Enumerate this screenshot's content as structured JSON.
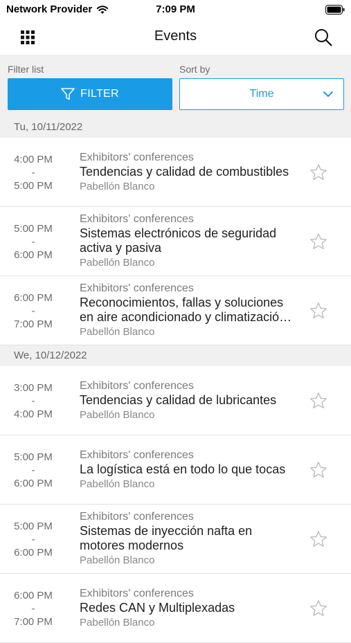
{
  "status": {
    "carrier": "Network Provider",
    "time": "7:09 PM"
  },
  "header": {
    "title": "Events"
  },
  "filter": {
    "filter_label": "Filter list",
    "sort_label": "Sort by",
    "filter_button": "FILTER",
    "sort_value": "Time"
  },
  "colors": {
    "accent": "#1a9be6",
    "section_bg": "#f0f0f0",
    "star": "#b8b8b8"
  },
  "days": [
    {
      "date": "Tu, 10/11/2022",
      "events": [
        {
          "start": "4:00 PM",
          "sep": "-",
          "end": "5:00 PM",
          "category": "Exhibitors' conferences",
          "title_lines": [
            "Tendencias y calidad de combustibles"
          ],
          "location": "Pabellón Blanco"
        },
        {
          "start": "5:00 PM",
          "sep": "-",
          "end": "6:00 PM",
          "category": "Exhibitors' conferences",
          "title_lines": [
            "Sistemas electrónicos de seguridad",
            "activa y pasiva"
          ],
          "location": "Pabellón Blanco"
        },
        {
          "start": "6:00 PM",
          "sep": "-",
          "end": "7:00 PM",
          "category": "Exhibitors' conferences",
          "title_lines": [
            "Reconocimientos, fallas y soluciones",
            "en aire acondicionado y climatizació…"
          ],
          "location": "Pabellón Blanco"
        }
      ]
    },
    {
      "date": "We, 10/12/2022",
      "events": [
        {
          "start": "3:00 PM",
          "sep": "-",
          "end": "4:00 PM",
          "category": "Exhibitors' conferences",
          "title_lines": [
            "Tendencias y calidad de lubricantes"
          ],
          "location": "Pabellón Blanco"
        },
        {
          "start": "5:00 PM",
          "sep": "-",
          "end": "6:00 PM",
          "category": "Exhibitors' conferences",
          "title_lines": [
            "La logística está en todo lo que tocas"
          ],
          "location": "Pabellón Blanco"
        },
        {
          "start": "5:00 PM",
          "sep": "-",
          "end": "6:00 PM",
          "category": "Exhibitors' conferences",
          "title_lines": [
            "Sistemas de inyección nafta en",
            "motores modernos"
          ],
          "location": "Pabellón Blanco"
        },
        {
          "start": "6:00 PM",
          "sep": "-",
          "end": "7:00 PM",
          "category": "Exhibitors' conferences",
          "title_lines": [
            "Redes CAN y Multiplexadas"
          ],
          "location": "Pabellón Blanco"
        }
      ]
    }
  ]
}
